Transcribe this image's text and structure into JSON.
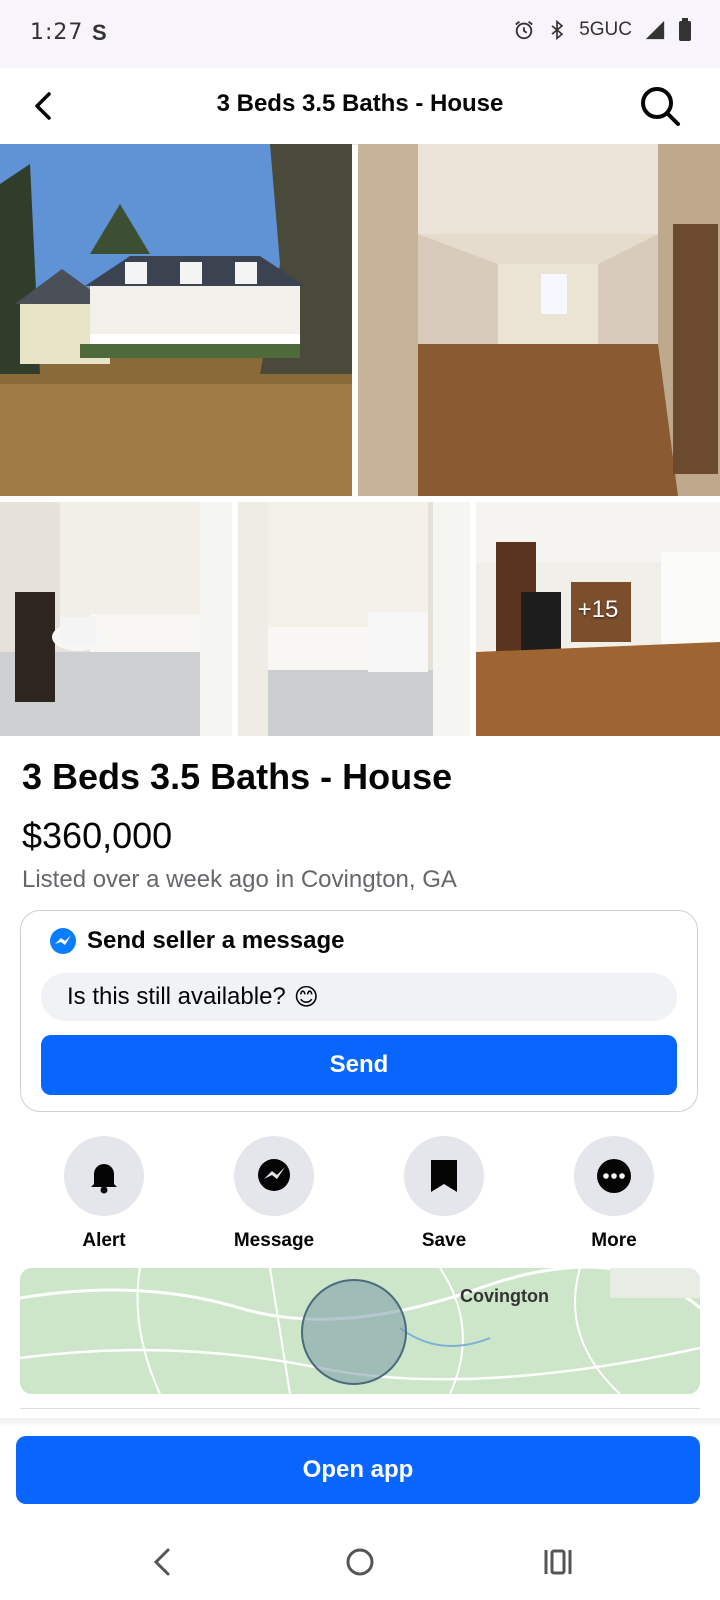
{
  "status_bar": {
    "time": "1:27",
    "app_icon": "S",
    "network": "5GUC"
  },
  "header": {
    "title": "3 Beds 3.5 Baths - House"
  },
  "gallery": {
    "more_count": "+15"
  },
  "listing": {
    "title": "3 Beds 3.5 Baths - House",
    "price": "$360,000",
    "meta": "Listed over a week ago in Covington, GA"
  },
  "message_card": {
    "header": "Send seller a message",
    "input_value": "Is this still available?",
    "emoji": "😊",
    "send_label": "Send"
  },
  "actions": [
    {
      "label": "Alert",
      "icon": "bell-icon"
    },
    {
      "label": "Message",
      "icon": "messenger-icon"
    },
    {
      "label": "Save",
      "icon": "bookmark-icon"
    },
    {
      "label": "More",
      "icon": "more-dots-icon"
    }
  ],
  "map": {
    "label": "Covington"
  },
  "open_app_label": "Open app",
  "colors": {
    "accent": "#0866ff",
    "secondary_text": "#65676b",
    "chip_bg": "#e4e6eb"
  }
}
